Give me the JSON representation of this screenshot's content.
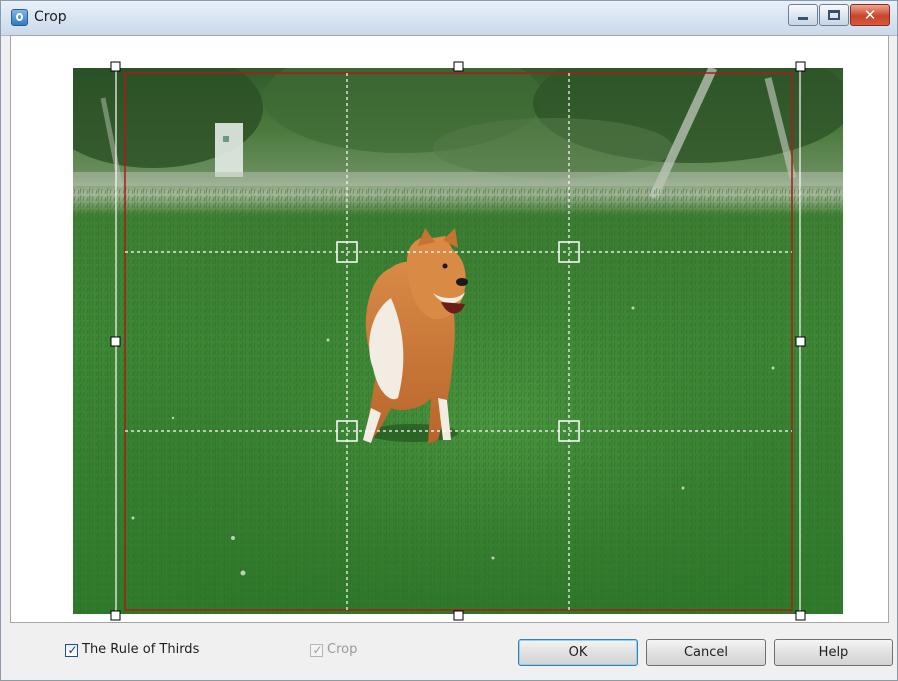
{
  "window": {
    "title": "Crop",
    "app_icon": "crop-app-icon",
    "caption_buttons": [
      "minimize-icon",
      "restore-icon",
      "close-icon"
    ],
    "close_glyph": "✕"
  },
  "preview": {
    "subject": "dog-running-on-grass-photo",
    "crop_frame_color": "#b01919",
    "grid": "The Rule of Thirds"
  },
  "options": {
    "rule_of_thirds_label": "The Rule of Thirds",
    "rule_of_thirds_checked": true,
    "crop_label": "Crop",
    "crop_checked": true,
    "crop_enabled": false,
    "check_glyph": "✓"
  },
  "buttons": {
    "ok": "OK",
    "cancel": "Cancel",
    "help": "Help"
  }
}
